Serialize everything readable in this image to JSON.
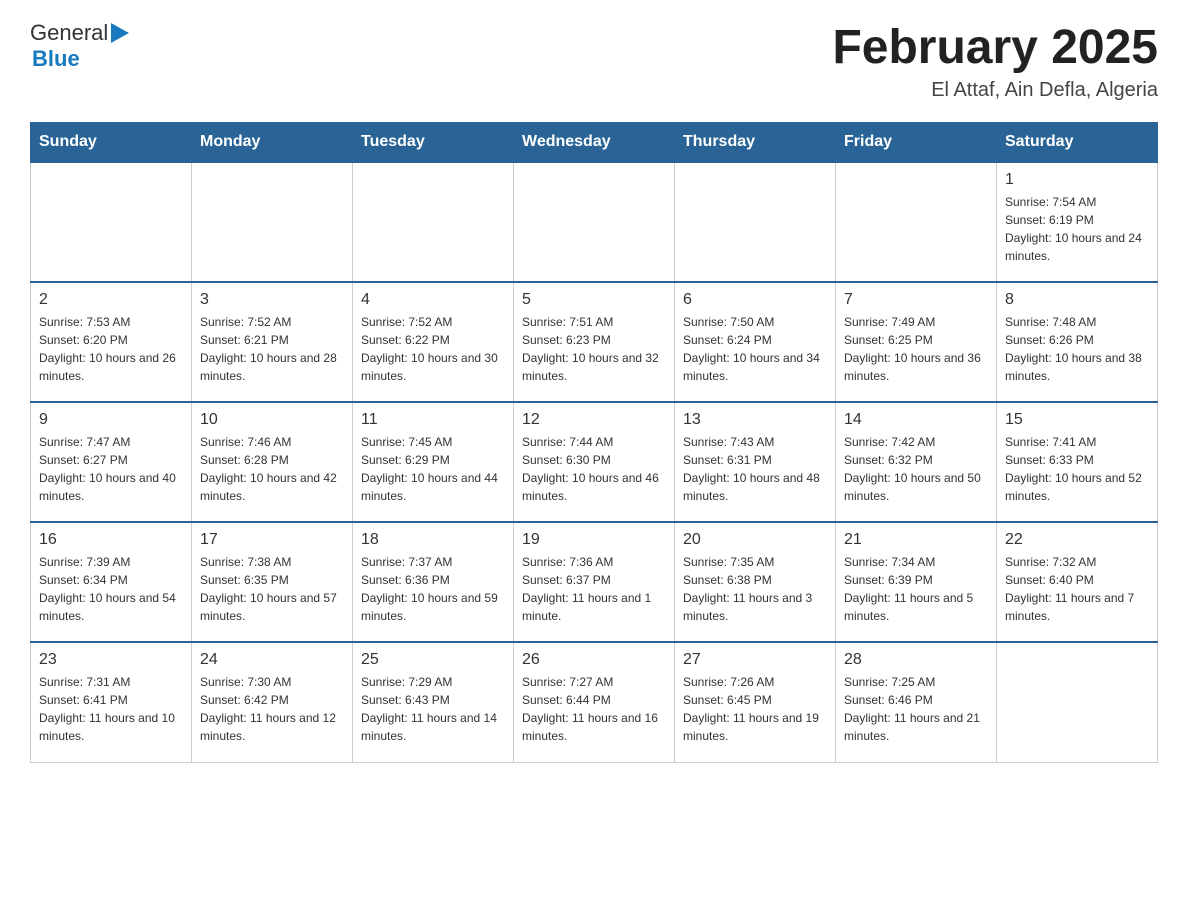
{
  "header": {
    "logo_general": "General",
    "logo_blue": "Blue",
    "month_year": "February 2025",
    "location": "El Attaf, Ain Defla, Algeria"
  },
  "weekdays": [
    "Sunday",
    "Monday",
    "Tuesday",
    "Wednesday",
    "Thursday",
    "Friday",
    "Saturday"
  ],
  "weeks": [
    [
      {
        "day": "",
        "sunrise": "",
        "sunset": "",
        "daylight": ""
      },
      {
        "day": "",
        "sunrise": "",
        "sunset": "",
        "daylight": ""
      },
      {
        "day": "",
        "sunrise": "",
        "sunset": "",
        "daylight": ""
      },
      {
        "day": "",
        "sunrise": "",
        "sunset": "",
        "daylight": ""
      },
      {
        "day": "",
        "sunrise": "",
        "sunset": "",
        "daylight": ""
      },
      {
        "day": "",
        "sunrise": "",
        "sunset": "",
        "daylight": ""
      },
      {
        "day": "1",
        "sunrise": "Sunrise: 7:54 AM",
        "sunset": "Sunset: 6:19 PM",
        "daylight": "Daylight: 10 hours and 24 minutes."
      }
    ],
    [
      {
        "day": "2",
        "sunrise": "Sunrise: 7:53 AM",
        "sunset": "Sunset: 6:20 PM",
        "daylight": "Daylight: 10 hours and 26 minutes."
      },
      {
        "day": "3",
        "sunrise": "Sunrise: 7:52 AM",
        "sunset": "Sunset: 6:21 PM",
        "daylight": "Daylight: 10 hours and 28 minutes."
      },
      {
        "day": "4",
        "sunrise": "Sunrise: 7:52 AM",
        "sunset": "Sunset: 6:22 PM",
        "daylight": "Daylight: 10 hours and 30 minutes."
      },
      {
        "day": "5",
        "sunrise": "Sunrise: 7:51 AM",
        "sunset": "Sunset: 6:23 PM",
        "daylight": "Daylight: 10 hours and 32 minutes."
      },
      {
        "day": "6",
        "sunrise": "Sunrise: 7:50 AM",
        "sunset": "Sunset: 6:24 PM",
        "daylight": "Daylight: 10 hours and 34 minutes."
      },
      {
        "day": "7",
        "sunrise": "Sunrise: 7:49 AM",
        "sunset": "Sunset: 6:25 PM",
        "daylight": "Daylight: 10 hours and 36 minutes."
      },
      {
        "day": "8",
        "sunrise": "Sunrise: 7:48 AM",
        "sunset": "Sunset: 6:26 PM",
        "daylight": "Daylight: 10 hours and 38 minutes."
      }
    ],
    [
      {
        "day": "9",
        "sunrise": "Sunrise: 7:47 AM",
        "sunset": "Sunset: 6:27 PM",
        "daylight": "Daylight: 10 hours and 40 minutes."
      },
      {
        "day": "10",
        "sunrise": "Sunrise: 7:46 AM",
        "sunset": "Sunset: 6:28 PM",
        "daylight": "Daylight: 10 hours and 42 minutes."
      },
      {
        "day": "11",
        "sunrise": "Sunrise: 7:45 AM",
        "sunset": "Sunset: 6:29 PM",
        "daylight": "Daylight: 10 hours and 44 minutes."
      },
      {
        "day": "12",
        "sunrise": "Sunrise: 7:44 AM",
        "sunset": "Sunset: 6:30 PM",
        "daylight": "Daylight: 10 hours and 46 minutes."
      },
      {
        "day": "13",
        "sunrise": "Sunrise: 7:43 AM",
        "sunset": "Sunset: 6:31 PM",
        "daylight": "Daylight: 10 hours and 48 minutes."
      },
      {
        "day": "14",
        "sunrise": "Sunrise: 7:42 AM",
        "sunset": "Sunset: 6:32 PM",
        "daylight": "Daylight: 10 hours and 50 minutes."
      },
      {
        "day": "15",
        "sunrise": "Sunrise: 7:41 AM",
        "sunset": "Sunset: 6:33 PM",
        "daylight": "Daylight: 10 hours and 52 minutes."
      }
    ],
    [
      {
        "day": "16",
        "sunrise": "Sunrise: 7:39 AM",
        "sunset": "Sunset: 6:34 PM",
        "daylight": "Daylight: 10 hours and 54 minutes."
      },
      {
        "day": "17",
        "sunrise": "Sunrise: 7:38 AM",
        "sunset": "Sunset: 6:35 PM",
        "daylight": "Daylight: 10 hours and 57 minutes."
      },
      {
        "day": "18",
        "sunrise": "Sunrise: 7:37 AM",
        "sunset": "Sunset: 6:36 PM",
        "daylight": "Daylight: 10 hours and 59 minutes."
      },
      {
        "day": "19",
        "sunrise": "Sunrise: 7:36 AM",
        "sunset": "Sunset: 6:37 PM",
        "daylight": "Daylight: 11 hours and 1 minute."
      },
      {
        "day": "20",
        "sunrise": "Sunrise: 7:35 AM",
        "sunset": "Sunset: 6:38 PM",
        "daylight": "Daylight: 11 hours and 3 minutes."
      },
      {
        "day": "21",
        "sunrise": "Sunrise: 7:34 AM",
        "sunset": "Sunset: 6:39 PM",
        "daylight": "Daylight: 11 hours and 5 minutes."
      },
      {
        "day": "22",
        "sunrise": "Sunrise: 7:32 AM",
        "sunset": "Sunset: 6:40 PM",
        "daylight": "Daylight: 11 hours and 7 minutes."
      }
    ],
    [
      {
        "day": "23",
        "sunrise": "Sunrise: 7:31 AM",
        "sunset": "Sunset: 6:41 PM",
        "daylight": "Daylight: 11 hours and 10 minutes."
      },
      {
        "day": "24",
        "sunrise": "Sunrise: 7:30 AM",
        "sunset": "Sunset: 6:42 PM",
        "daylight": "Daylight: 11 hours and 12 minutes."
      },
      {
        "day": "25",
        "sunrise": "Sunrise: 7:29 AM",
        "sunset": "Sunset: 6:43 PM",
        "daylight": "Daylight: 11 hours and 14 minutes."
      },
      {
        "day": "26",
        "sunrise": "Sunrise: 7:27 AM",
        "sunset": "Sunset: 6:44 PM",
        "daylight": "Daylight: 11 hours and 16 minutes."
      },
      {
        "day": "27",
        "sunrise": "Sunrise: 7:26 AM",
        "sunset": "Sunset: 6:45 PM",
        "daylight": "Daylight: 11 hours and 19 minutes."
      },
      {
        "day": "28",
        "sunrise": "Sunrise: 7:25 AM",
        "sunset": "Sunset: 6:46 PM",
        "daylight": "Daylight: 11 hours and 21 minutes."
      },
      {
        "day": "",
        "sunrise": "",
        "sunset": "",
        "daylight": ""
      }
    ]
  ]
}
